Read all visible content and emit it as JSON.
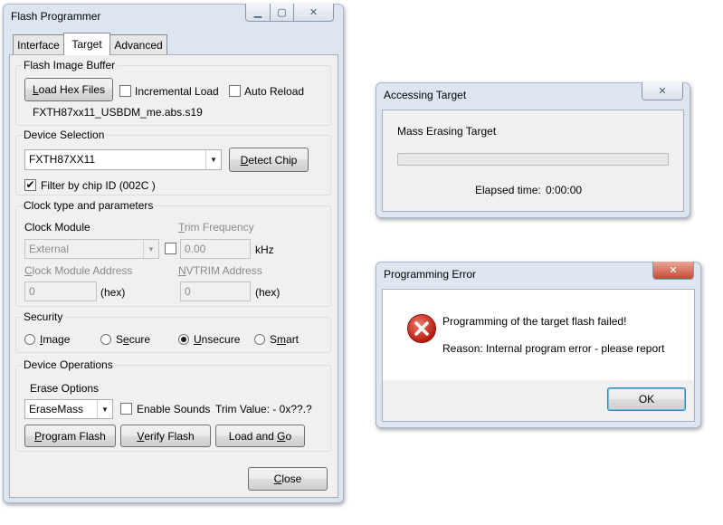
{
  "flash_programmer": {
    "title": "Flash Programmer",
    "tabs": [
      {
        "label": "Interface",
        "mnemonic_prefix": "",
        "mnemonic": "",
        "rest": "Interface"
      },
      {
        "label": "Target"
      },
      {
        "label": "Advanced"
      }
    ],
    "flash_image_buffer": {
      "label": "Flash Image Buffer",
      "load_hex_files": {
        "m": "L",
        "rest": "oad Hex Files"
      },
      "incremental_load": "Incremental Load",
      "auto_reload": "Auto Reload",
      "filename": "FXTH87xx11_USBDM_me.abs.s19"
    },
    "device_selection": {
      "label": "Device Selection",
      "device": "FXTH87XX11",
      "detect_chip": {
        "m": "D",
        "rest": "etect Chip"
      },
      "filter_by_chip_id": "Filter by chip ID (002C )"
    },
    "clock": {
      "label": "Clock type and parameters",
      "clock_module_label": "Clock Module",
      "clock_module_value": "External",
      "trim_frequency_label": {
        "m": "T",
        "rest": "rim Frequency"
      },
      "trim_frequency_value": "0.00",
      "trim_frequency_unit": "kHz",
      "clock_module_address_label": {
        "m": "C",
        "rest": "lock Module Address"
      },
      "clock_module_address_value": "0",
      "clock_module_address_unit": "(hex)",
      "nvtrim_address_label": {
        "m": "N",
        "rest": "VTRIM Address"
      },
      "nvtrim_address_value": "0",
      "nvtrim_address_unit": "(hex)"
    },
    "security": {
      "label": "Security",
      "options": [
        {
          "m": "I",
          "rest": "mage"
        },
        {
          "pre": "S",
          "m": "e",
          "rest": "cure"
        },
        {
          "m": "U",
          "rest": "nsecure"
        },
        {
          "pre": "S",
          "m": "m",
          "rest": "art"
        }
      ],
      "selected": "Unsecure"
    },
    "device_operations": {
      "label": "Device Operations",
      "erase_options_label": "Erase Options",
      "erase_value": "EraseMass",
      "enable_sounds": "Enable Sounds",
      "trim_value": "Trim Value: - 0x??.?",
      "program_flash": {
        "m": "P",
        "rest": "rogram Flash"
      },
      "verify_flash": {
        "m": "V",
        "rest": "erify Flash"
      },
      "load_and_go": {
        "pre": "Load and ",
        "m": "G",
        "rest": "o"
      }
    },
    "close": {
      "m": "C",
      "rest": "lose"
    }
  },
  "accessing_target": {
    "title": "Accessing Target",
    "status": "Mass Erasing Target",
    "progress": 0,
    "elapsed_label": "Elapsed time:",
    "elapsed_value": "0:00:00"
  },
  "programming_error": {
    "title": "Programming Error",
    "message": "Programming of the target flash failed!",
    "reason": "Reason: Internal program error - please report",
    "ok": "OK"
  }
}
